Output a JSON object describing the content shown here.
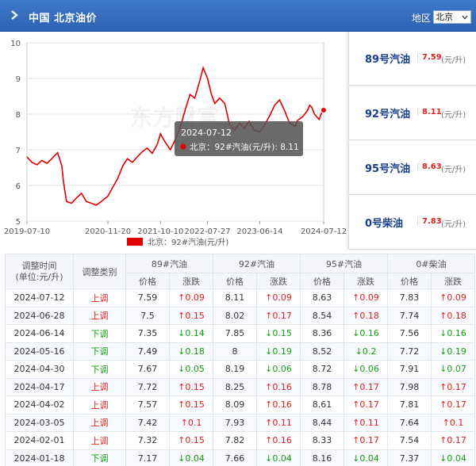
{
  "header": {
    "title": "中国 北京油价",
    "region_label": "地区",
    "region_value": "北京"
  },
  "tooltip": {
    "date": "2024-07-12",
    "text": "北京：92#汽油(元/升): 8.11"
  },
  "watermark": "东方财富",
  "legend_label": "北京：92#汽油(元/升)",
  "chart_data": {
    "type": "line",
    "title": "",
    "ylim": [
      5,
      10
    ],
    "yticks": [
      5,
      6,
      7,
      8,
      9,
      10
    ],
    "xtick_labels": [
      "2019-07-10",
      "2020-11-20",
      "2021-10-10",
      "2022-07-27",
      "2023-06-14",
      "2024-07-12"
    ],
    "grid": true,
    "legend_position": "bottom",
    "series": [
      {
        "name": "北京：92#汽油(元/升)",
        "color": "#e00000",
        "points": [
          [
            "2019-07-10",
            6.8
          ],
          [
            "2019-08-10",
            6.65
          ],
          [
            "2019-09-10",
            6.58
          ],
          [
            "2019-10-10",
            6.7
          ],
          [
            "2019-11-10",
            6.62
          ],
          [
            "2019-12-10",
            6.75
          ],
          [
            "2020-01-15",
            6.92
          ],
          [
            "2020-02-10",
            6.55
          ],
          [
            "2020-02-20",
            6.1
          ],
          [
            "2020-03-10",
            5.55
          ],
          [
            "2020-04-10",
            5.5
          ],
          [
            "2020-05-10",
            5.65
          ],
          [
            "2020-06-10",
            5.78
          ],
          [
            "2020-07-10",
            5.55
          ],
          [
            "2020-08-10",
            5.5
          ],
          [
            "2020-09-10",
            5.45
          ],
          [
            "2020-10-10",
            5.55
          ],
          [
            "2020-11-20",
            5.7
          ],
          [
            "2020-12-20",
            5.95
          ],
          [
            "2021-01-20",
            6.2
          ],
          [
            "2021-02-20",
            6.55
          ],
          [
            "2021-03-20",
            6.75
          ],
          [
            "2021-04-20",
            6.65
          ],
          [
            "2021-05-20",
            6.8
          ],
          [
            "2021-06-20",
            6.95
          ],
          [
            "2021-07-20",
            7.05
          ],
          [
            "2021-08-20",
            6.9
          ],
          [
            "2021-09-20",
            7.15
          ],
          [
            "2021-10-10",
            7.45
          ],
          [
            "2021-11-10",
            7.2
          ],
          [
            "2021-12-10",
            7.0
          ],
          [
            "2022-01-10",
            7.3
          ],
          [
            "2022-02-10",
            7.65
          ],
          [
            "2022-03-10",
            8.1
          ],
          [
            "2022-04-10",
            8.55
          ],
          [
            "2022-05-10",
            8.45
          ],
          [
            "2022-06-10",
            8.95
          ],
          [
            "2022-06-30",
            9.3
          ],
          [
            "2022-07-27",
            9.0
          ],
          [
            "2022-08-20",
            8.55
          ],
          [
            "2022-09-10",
            8.3
          ],
          [
            "2022-10-10",
            8.45
          ],
          [
            "2022-11-10",
            8.3
          ],
          [
            "2022-12-10",
            7.7
          ],
          [
            "2023-01-10",
            7.55
          ],
          [
            "2023-02-10",
            7.75
          ],
          [
            "2023-03-10",
            7.6
          ],
          [
            "2023-04-10",
            7.8
          ],
          [
            "2023-05-10",
            7.55
          ],
          [
            "2023-06-14",
            7.5
          ],
          [
            "2023-07-14",
            7.7
          ],
          [
            "2023-08-14",
            7.95
          ],
          [
            "2023-09-14",
            8.25
          ],
          [
            "2023-10-14",
            8.4
          ],
          [
            "2023-11-14",
            8.1
          ],
          [
            "2023-12-14",
            7.75
          ],
          [
            "2024-01-18",
            7.66
          ],
          [
            "2024-02-01",
            7.82
          ],
          [
            "2024-03-05",
            7.93
          ],
          [
            "2024-04-02",
            8.09
          ],
          [
            "2024-04-17",
            8.25
          ],
          [
            "2024-04-30",
            8.19
          ],
          [
            "2024-05-16",
            8.0
          ],
          [
            "2024-06-14",
            7.85
          ],
          [
            "2024-06-28",
            8.02
          ],
          [
            "2024-07-12",
            8.11
          ]
        ]
      }
    ]
  },
  "prices": [
    {
      "type": "89号汽油",
      "value": "7.59",
      "unit": "(元/升)"
    },
    {
      "type": "92号汽油",
      "value": "8.11",
      "unit": "(元/升)"
    },
    {
      "type": "95号汽油",
      "value": "8.63",
      "unit": "(元/升)"
    },
    {
      "type": "0号柴油",
      "value": "7.83",
      "unit": "(元/升)"
    }
  ],
  "table": {
    "col_time": "调整时间",
    "col_time_sub": "(单位:元/升)",
    "col_type": "调整类别",
    "fuel_headers": [
      "89#汽油",
      "92#汽油",
      "95#汽油",
      "0#柴油"
    ],
    "sub_price": "价格",
    "sub_change": "涨跌",
    "rows": [
      {
        "date": "2024-07-12",
        "kind": "上调",
        "dir": "up",
        "vals": [
          "7.59",
          "↑0.09",
          "8.11",
          "↑0.09",
          "8.63",
          "↑0.09",
          "7.83",
          "↑0.09"
        ]
      },
      {
        "date": "2024-06-28",
        "kind": "上调",
        "dir": "up",
        "vals": [
          "7.5",
          "↑0.15",
          "8.02",
          "↑0.17",
          "8.54",
          "↑0.18",
          "7.74",
          "↑0.18"
        ]
      },
      {
        "date": "2024-06-14",
        "kind": "下调",
        "dir": "down",
        "vals": [
          "7.35",
          "↓0.14",
          "7.85",
          "↓0.15",
          "8.36",
          "↓0.16",
          "7.56",
          "↓0.16"
        ]
      },
      {
        "date": "2024-05-16",
        "kind": "下调",
        "dir": "down",
        "vals": [
          "7.49",
          "↓0.18",
          "8",
          "↓0.19",
          "8.52",
          "↓0.2",
          "7.72",
          "↓0.19"
        ]
      },
      {
        "date": "2024-04-30",
        "kind": "下调",
        "dir": "down",
        "vals": [
          "7.67",
          "↓0.05",
          "8.19",
          "↓0.06",
          "8.72",
          "↓0.06",
          "7.91",
          "↓0.07"
        ]
      },
      {
        "date": "2024-04-17",
        "kind": "上调",
        "dir": "up",
        "vals": [
          "7.72",
          "↑0.15",
          "8.25",
          "↑0.16",
          "8.78",
          "↑0.17",
          "7.98",
          "↑0.17"
        ]
      },
      {
        "date": "2024-04-02",
        "kind": "上调",
        "dir": "up",
        "vals": [
          "7.57",
          "↑0.15",
          "8.09",
          "↑0.16",
          "8.61",
          "↑0.17",
          "7.81",
          "↑0.17"
        ]
      },
      {
        "date": "2024-03-05",
        "kind": "上调",
        "dir": "up",
        "vals": [
          "7.42",
          "↑0.1",
          "7.93",
          "↑0.11",
          "8.44",
          "↑0.11",
          "7.64",
          "↑0.1"
        ]
      },
      {
        "date": "2024-02-01",
        "kind": "上调",
        "dir": "up",
        "vals": [
          "7.32",
          "↑0.15",
          "7.82",
          "↑0.16",
          "8.33",
          "↑0.17",
          "7.54",
          "↑0.17"
        ]
      },
      {
        "date": "2024-01-18",
        "kind": "下调",
        "dir": "down",
        "vals": [
          "7.17",
          "↓0.04",
          "7.66",
          "↓0.04",
          "8.16",
          "↓0.04",
          "7.37",
          "↓0.04"
        ]
      }
    ]
  },
  "colors": {
    "header_bg": "#2c62b3",
    "line": "#e00000",
    "up": "#e02020",
    "down": "#13a013",
    "price_type": "#1b3f8b"
  }
}
